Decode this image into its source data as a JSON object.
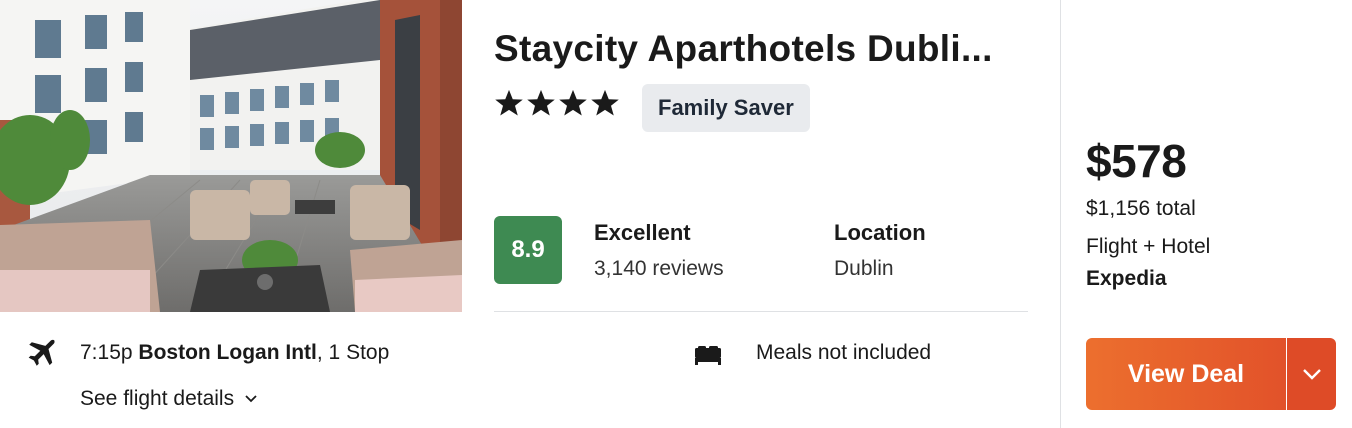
{
  "hotel": {
    "name": "Staycity Aparthotels Dubli...",
    "star_rating": 4,
    "badge": "Family Saver",
    "image_icon": "hotel-courtyard-photo"
  },
  "rating": {
    "score": "8.9",
    "label": "Excellent",
    "reviews": "3,140 reviews",
    "score_color": "#3e8a52"
  },
  "location": {
    "label": "Location",
    "value": "Dublin"
  },
  "flight": {
    "icon": "airplane-icon",
    "time": "7:15p",
    "airport": "Boston Logan Intl",
    "stops": ", 1 Stop",
    "details_link": "See flight details"
  },
  "amenities": {
    "icon": "bed-icon",
    "meals": "Meals not included"
  },
  "price": {
    "amount": "$578",
    "total": "$1,156 total",
    "product": "Flight + Hotel",
    "provider": "Expedia"
  },
  "cta": {
    "label": "View Deal",
    "accent": "#e8602c"
  }
}
